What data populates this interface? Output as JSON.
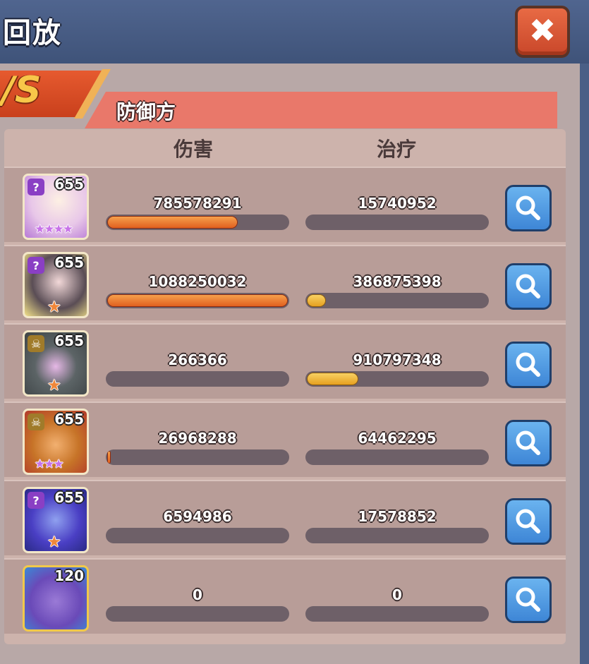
{
  "header": {
    "title": "回放",
    "close_icon": "close-icon"
  },
  "vs_badge": "/S",
  "side_label": "防御方",
  "columns": {
    "damage": "伤害",
    "healing": "治疗"
  },
  "colors": {
    "damage_fill": "#e1601f",
    "heal_fill": "#e6a020",
    "search_button": "#3e86d6"
  },
  "rows": [
    {
      "level": "655",
      "class_icon": "question-icon",
      "stars": "★★★★",
      "damage": "785578291",
      "healing": "15740952",
      "damage_fraction": 0.72,
      "healing_fraction": 0.0
    },
    {
      "level": "655",
      "class_icon": "question-icon",
      "stars": "★",
      "damage": "1088250032",
      "healing": "386875398",
      "damage_fraction": 1.0,
      "healing_fraction": 0.1
    },
    {
      "level": "655",
      "class_icon": "skull-icon",
      "stars": "★",
      "damage": "266366",
      "healing": "910797348",
      "damage_fraction": 0.0,
      "healing_fraction": 0.28
    },
    {
      "level": "655",
      "class_icon": "skull-icon",
      "stars": "★★★",
      "damage": "26968288",
      "healing": "64462295",
      "damage_fraction": 0.01,
      "healing_fraction": 0.0
    },
    {
      "level": "655",
      "class_icon": "question-icon",
      "stars": "★",
      "damage": "6594986",
      "healing": "17578852",
      "damage_fraction": 0.0,
      "healing_fraction": 0.0
    },
    {
      "level": "120",
      "class_icon": "",
      "stars": "",
      "damage": "0",
      "healing": "0",
      "damage_fraction": 0.0,
      "healing_fraction": 0.0
    }
  ]
}
